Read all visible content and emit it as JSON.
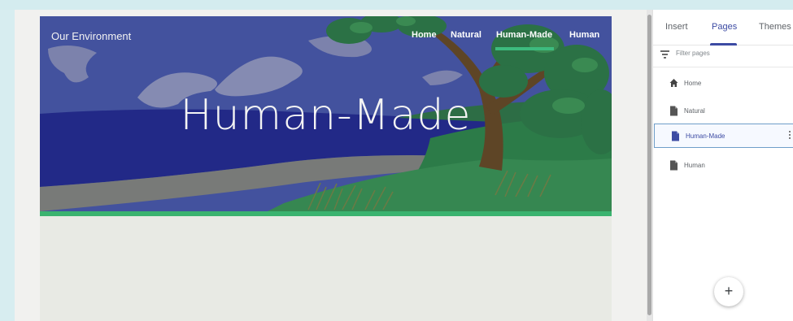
{
  "site": {
    "title": "Our Environment",
    "hero_title": "Human-Made",
    "nav": [
      "Home",
      "Natural",
      "Human-Made",
      "Human"
    ],
    "active_nav": "Human-Made"
  },
  "panel": {
    "tabs": [
      "Insert",
      "Pages",
      "Themes"
    ],
    "active_tab": "Pages",
    "filter_placeholder": "Filter pages",
    "pages": [
      {
        "label": "Home",
        "icon": "home-icon"
      },
      {
        "label": "Natural",
        "icon": "page-icon"
      },
      {
        "label": "Human-Made",
        "icon": "page-icon",
        "selected": true
      },
      {
        "label": "Human",
        "icon": "page-icon"
      }
    ],
    "add_button": "+"
  },
  "colors": {
    "accent_green": "#3bb36f",
    "selected_blue": "#3c4ba3",
    "sky": "#4a5ba4",
    "lake": "#22288a"
  }
}
